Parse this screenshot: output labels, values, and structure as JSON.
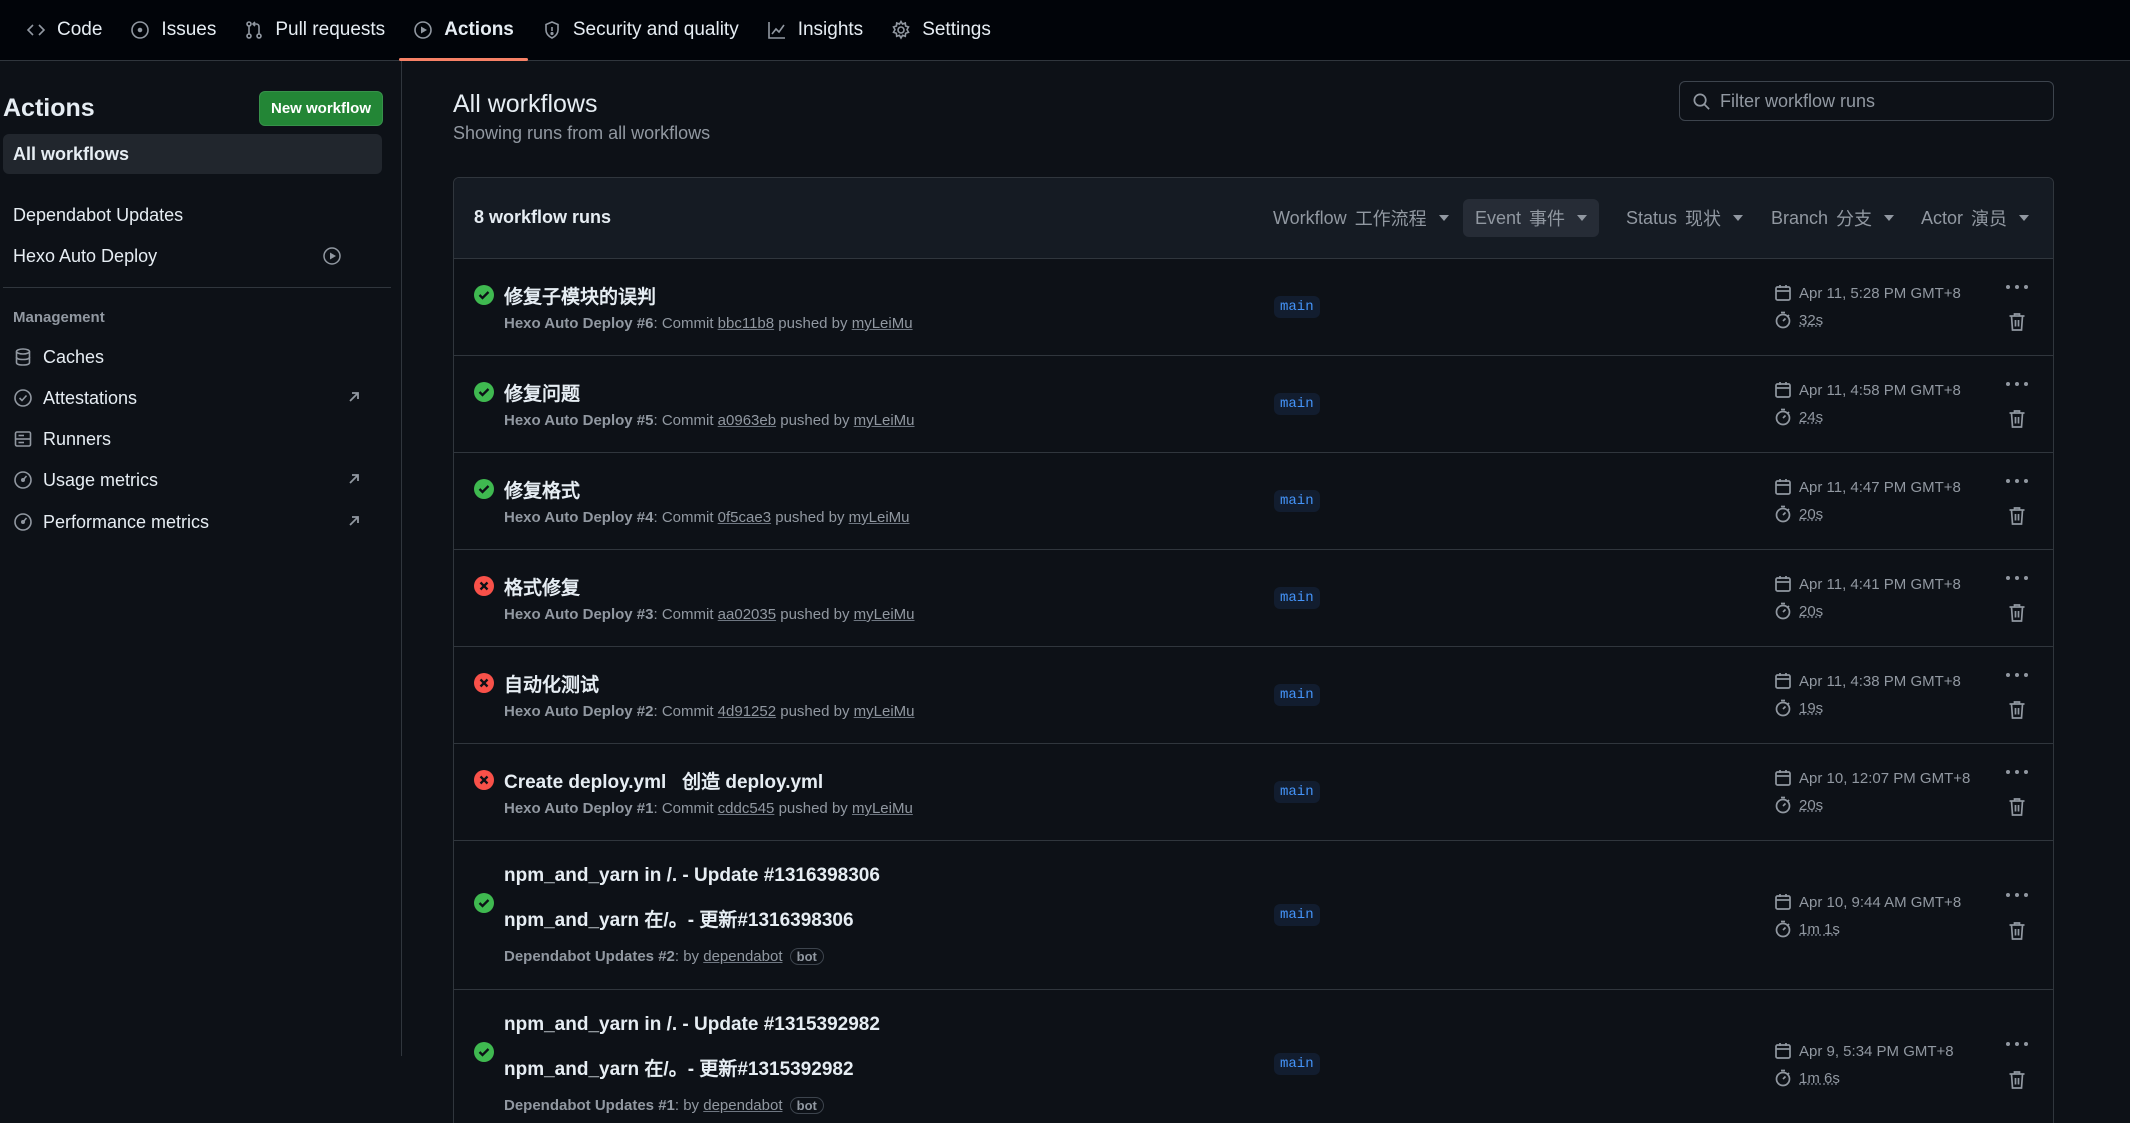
{
  "nav": {
    "tabs": [
      {
        "label": "Code",
        "icon": "code-icon"
      },
      {
        "label": "Issues",
        "icon": "issue-icon"
      },
      {
        "label": "Pull requests",
        "icon": "pull-request-icon"
      },
      {
        "label": "Actions",
        "icon": "play-icon",
        "active": true
      },
      {
        "label": "Security and quality",
        "icon": "shield-icon"
      },
      {
        "label": "Insights",
        "icon": "graph-icon"
      },
      {
        "label": "Settings",
        "icon": "gear-icon"
      }
    ]
  },
  "sidebar": {
    "title": "Actions",
    "new_workflow_label": "New workflow",
    "all_workflows_label": "All workflows",
    "workflows": [
      {
        "label": "Dependabot Updates"
      },
      {
        "label": "Hexo Auto Deploy"
      }
    ],
    "management_label": "Management",
    "management_items": [
      {
        "label": "Caches",
        "icon": "database-icon"
      },
      {
        "label": "Attestations",
        "icon": "verified-icon",
        "external": true
      },
      {
        "label": "Runners",
        "icon": "server-icon"
      },
      {
        "label": "Usage metrics",
        "icon": "meter-icon",
        "external": true
      },
      {
        "label": "Performance metrics",
        "icon": "meter-icon",
        "external": true
      }
    ]
  },
  "main": {
    "title": "All workflows",
    "subtitle": "Showing runs from all workflows",
    "filter_placeholder": "Filter workflow runs",
    "runs_count": "8 workflow runs",
    "filters": [
      {
        "label": "Workflow",
        "extra": "工作流程"
      },
      {
        "label": "Event",
        "extra": "事件"
      },
      {
        "label": "Status",
        "extra": "现状"
      },
      {
        "label": "Branch",
        "extra": "分支"
      },
      {
        "label": "Actor",
        "extra": "演员"
      }
    ],
    "runs": [
      {
        "status": "success",
        "title": "修复子模块的误判",
        "workflow": "Hexo Auto Deploy",
        "number": "#6",
        "commit": "bbc11b8",
        "actor": "myLeiMu",
        "branch": "main",
        "date": "Apr 11, 5:28 PM GMT+8",
        "duration": "32s"
      },
      {
        "status": "success",
        "title": "修复问题",
        "workflow": "Hexo Auto Deploy",
        "number": "#5",
        "commit": "a0963eb",
        "actor": "myLeiMu",
        "branch": "main",
        "date": "Apr 11, 4:58 PM GMT+8",
        "duration": "24s"
      },
      {
        "status": "success",
        "title": "修复格式",
        "workflow": "Hexo Auto Deploy",
        "number": "#4",
        "commit": "0f5cae3",
        "actor": "myLeiMu",
        "branch": "main",
        "date": "Apr 11, 4:47 PM GMT+8",
        "duration": "20s"
      },
      {
        "status": "failure",
        "title": "格式修复",
        "workflow": "Hexo Auto Deploy",
        "number": "#3",
        "commit": "aa02035",
        "actor": "myLeiMu",
        "branch": "main",
        "date": "Apr 11, 4:41 PM GMT+8",
        "duration": "20s"
      },
      {
        "status": "failure",
        "title": "自动化测试",
        "workflow": "Hexo Auto Deploy",
        "number": "#2",
        "commit": "4d91252",
        "actor": "myLeiMu",
        "branch": "main",
        "date": "Apr 11, 4:38 PM GMT+8",
        "duration": "19s"
      },
      {
        "status": "failure",
        "title": "Create deploy.yml   创造 deploy.yml",
        "workflow": "Hexo Auto Deploy",
        "number": "#1",
        "commit": "cddc545",
        "actor": "myLeiMu",
        "branch": "main",
        "date": "Apr 10, 12:07 PM GMT+8",
        "duration": "20s"
      },
      {
        "status": "success",
        "title": "npm_and_yarn in /. - Update #1316398306",
        "title2": "npm_and_yarn 在/。- 更新#1316398306",
        "workflow": "Dependabot Updates",
        "number": "#2",
        "actor": "dependabot",
        "badge": "bot",
        "branch": "main",
        "date": "Apr 10, 9:44 AM GMT+8",
        "duration": "1m 1s"
      },
      {
        "status": "success",
        "title": "npm_and_yarn in /. - Update #1315392982",
        "title2": "npm_and_yarn 在/。- 更新#1315392982",
        "workflow": "Dependabot Updates",
        "number": "#1",
        "actor": "dependabot",
        "badge": "bot",
        "branch": "main",
        "date": "Apr 9, 5:34 PM GMT+8",
        "duration": "1m 6s"
      }
    ],
    "text": {
      "commit_word": "Commit",
      "pushed_by": "pushed by",
      "by_word": "by"
    }
  }
}
